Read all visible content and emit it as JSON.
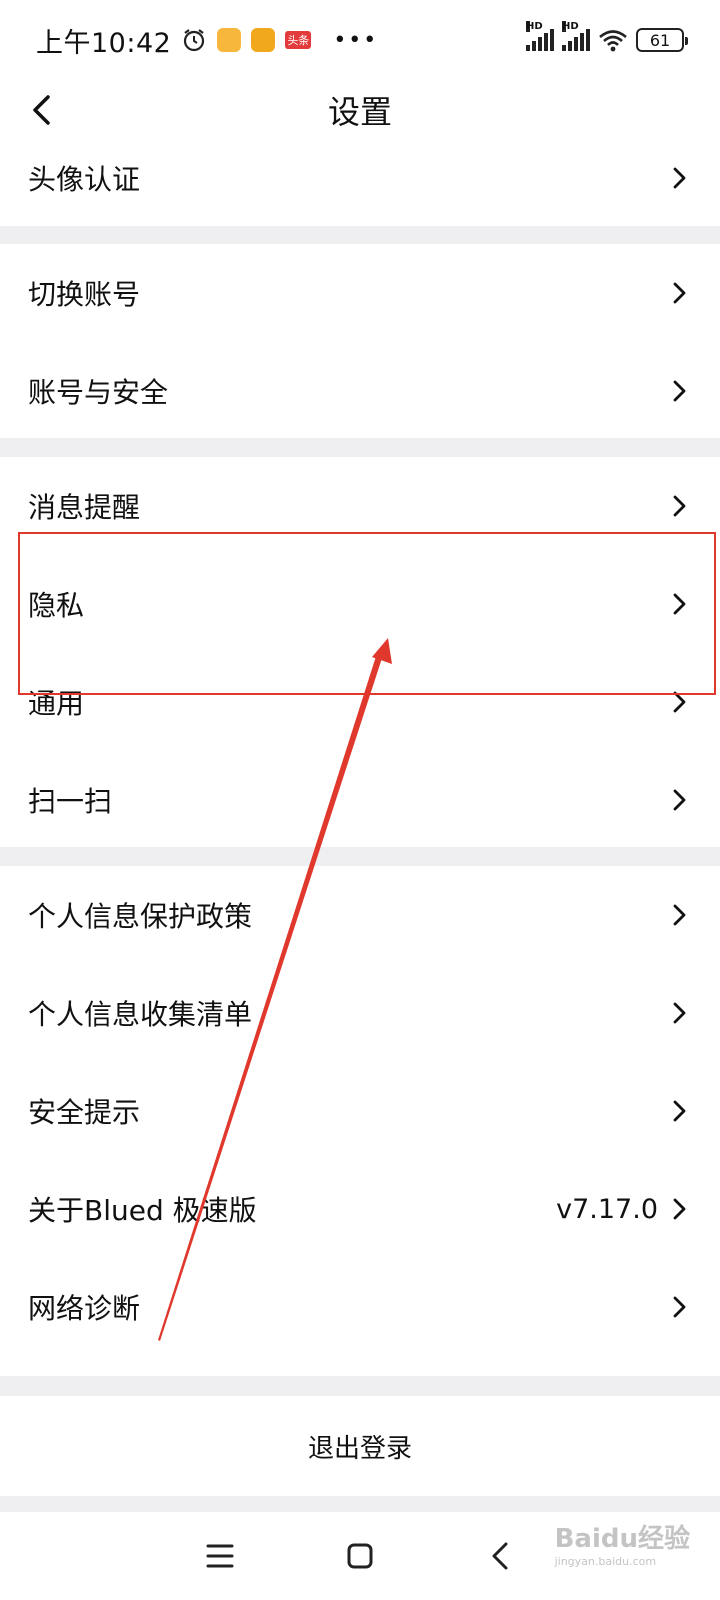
{
  "status_bar": {
    "time": "上午10:42",
    "badge_toutiao": "头条",
    "hd1": "HD",
    "hd2": "HD",
    "battery": "61"
  },
  "header": {
    "title": "设置"
  },
  "sections": {
    "s1": [
      {
        "label": "头像认证"
      }
    ],
    "s2": [
      {
        "label": "切换账号"
      },
      {
        "label": "账号与安全"
      }
    ],
    "s3": [
      {
        "label": "消息提醒"
      },
      {
        "label": "隐私"
      },
      {
        "label": "通用"
      },
      {
        "label": "扫一扫"
      }
    ],
    "s4": [
      {
        "label": "个人信息保护政策"
      },
      {
        "label": "个人信息收集清单"
      },
      {
        "label": "安全提示"
      },
      {
        "label": "关于Blued 极速版",
        "value": "v7.17.0"
      },
      {
        "label": "网络诊断"
      }
    ]
  },
  "logout_label": "退出登录",
  "watermark": {
    "text": "Baidu经验",
    "sub": "jingyan.baidu.com"
  },
  "colors": {
    "annotation": "#e0382c",
    "separator": "#efeff2"
  }
}
